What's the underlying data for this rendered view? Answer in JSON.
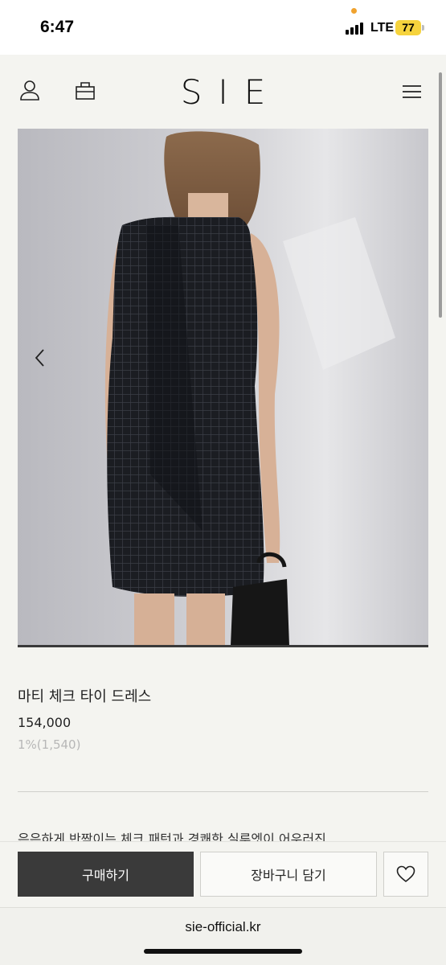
{
  "status_bar": {
    "time": "6:47",
    "network": "LTE",
    "battery": "77",
    "battery_color": "#f6d33d"
  },
  "header": {
    "logo": "SIE",
    "icons": [
      "user-icon",
      "shopping-bag-icon",
      "menu-icon"
    ]
  },
  "gallery": {
    "image_description": "Model wearing a sleeveless black check-pattern mini dress, photographed from behind, holding a black handbag",
    "prev_icon": "chevron-left-icon"
  },
  "product": {
    "name": "마티 체크 타이 드레스",
    "price": "154,000",
    "points": "1%(1,540)",
    "description": "은은하게 반짝이는 체크 패턴과 경쾌한 실루엣이 어우러진"
  },
  "actions": {
    "buy_label": "구매하기",
    "cart_label": "장바구니 담기",
    "wish_icon": "heart-icon",
    "buy_color": "#3a3a3a"
  },
  "browser": {
    "url": "sie-official.kr"
  }
}
